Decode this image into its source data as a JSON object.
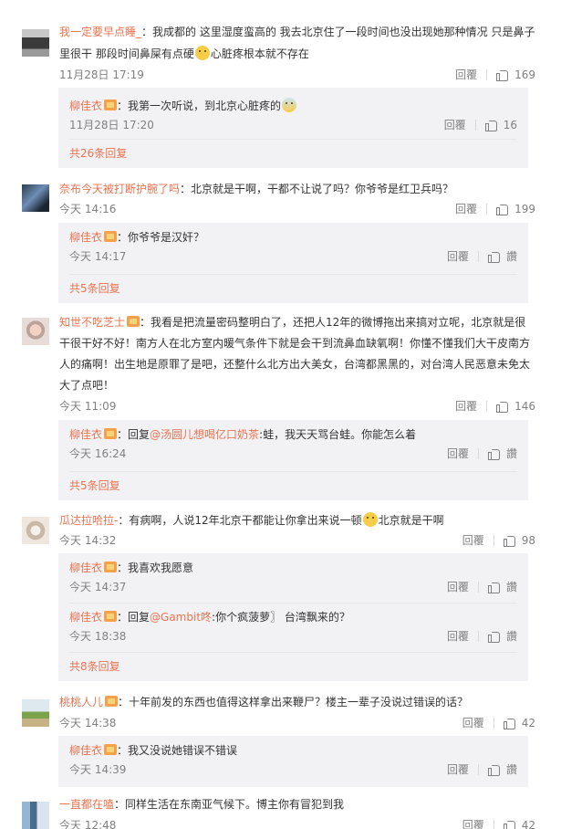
{
  "comments": [
    {
      "user": "我一定要早点睡_",
      "text_a": "：我成都的 这里湿度蛮高的  我去北京住了一段时间也没出现她那种情况  只是鼻子里很干  那段时间鼻屎有点硬",
      "text_b": "心脏疼根本就不存在",
      "time": "11月28日 17:19",
      "reply_label": "回覆",
      "likes": "169"
    },
    {
      "user": "奈布今天被打断护腕了吗",
      "text": "：北京就是干啊，干都不让说了吗？你爷爷是红卫兵吗？",
      "time": "今天 14:16",
      "reply_label": "回覆",
      "likes": "199"
    },
    {
      "user": "知世不吃芝士",
      "text": "：我看是把流量密码整明白了，还把人12年的微博拖出来搞对立呢，北京就是很干很干好不好！南方人在北方室内暖气条件下就是会干到流鼻血缺氧啊！你懂不懂我们大干皮南方人的痛啊！出生地是原罪了是吧，还整什么北方出大美女，台湾都黑黑的，对台湾人民恶意未免太大了点吧！",
      "time": "今天 11:09",
      "reply_label": "回覆",
      "likes": "146"
    },
    {
      "user": "瓜达拉哈拉-",
      "text_a": "：有病啊，人说12年北京干都能让你拿出来说一顿",
      "text_b": "北京就是干啊",
      "time": "今天 14:32",
      "reply_label": "回覆",
      "likes": "98"
    },
    {
      "user": "桃桃人儿",
      "text": "：十年前发的东西也值得这样拿出来鞭尸？楼主一辈子没说过错误的话？",
      "time": "今天 14:38",
      "reply_label": "回覆",
      "likes": "42"
    },
    {
      "user": "一直都在嗑",
      "text": "：同样生活在东南亚气候下。博主你有冒犯到我",
      "time": "今天 12:48",
      "reply_label": "回覆",
      "likes": "42"
    }
  ],
  "replies": {
    "r1": {
      "user": "柳佳衣",
      "text_a": "：我第一次听说，到北京心脏疼的",
      "time": "11月28日 17:20",
      "reply_label": "回覆",
      "likes": "16",
      "more": "共26条回复"
    },
    "r2": {
      "user": "柳佳衣",
      "text": "：你爷爷是汉奸？",
      "time": "今天 14:17",
      "reply_label": "回覆",
      "like_label": "讚",
      "more": "共5条回复"
    },
    "r3": {
      "user": "柳佳衣",
      "prefix": "：回复",
      "mention": "@汤圆儿想喝亿口奶茶",
      "text": ":蛙，我天天骂台蛙。你能怎么着",
      "time": "今天 16:24",
      "reply_label": "回覆",
      "like_label": "讚",
      "more": "共5条回复"
    },
    "r4a": {
      "user": "柳佳衣",
      "text": "：我喜欢我愿意",
      "time": "今天 14:37",
      "reply_label": "回覆",
      "like_label": "讚"
    },
    "r4b": {
      "user": "柳佳衣",
      "prefix": "：回复",
      "mention": "@Gambit咚",
      "text": ":你个疯菠萝〗  台湾飘来的？",
      "time": "今天 18:38",
      "reply_label": "回覆",
      "like_label": "讚",
      "more": "共8条回复"
    },
    "r5": {
      "user": "柳佳衣",
      "text": "：我又没说她错误不错误",
      "time": "今天 14:39",
      "reply_label": "回覆",
      "like_label": "讚"
    }
  }
}
